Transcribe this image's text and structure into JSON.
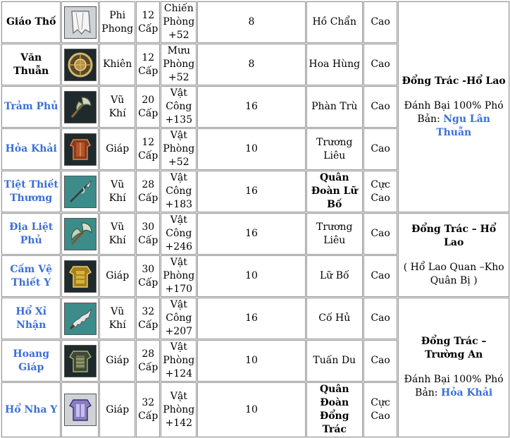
{
  "rows": [
    {
      "name": "Giáo Thố",
      "name_color": "black",
      "icon": "white-cloak-icon",
      "icon_bg": "ic-grey",
      "type": "Phi Phong",
      "level": "12 Cấp",
      "stat": "Chiến Phòng +52",
      "qty": "8",
      "source": "Hồ Chẩn",
      "source_bold": false,
      "grade": "Cao"
    },
    {
      "name": "Văn Thuẫn",
      "name_color": "black",
      "icon": "round-shield-icon",
      "icon_bg": "ic-dark",
      "type": "Khiên",
      "level": "12 Cấp",
      "stat": "Mưu Phòng +52",
      "qty": "8",
      "source": "Hoa Hùng",
      "source_bold": false,
      "grade": "Cao"
    },
    {
      "name": "Trảm Phủ",
      "name_color": "blue",
      "icon": "axe-icon",
      "icon_bg": "ic-dark",
      "type": "Vũ Khí",
      "level": "20 Cấp",
      "stat": "Vật Công +135",
      "qty": "16",
      "source": "Phàn Trù",
      "source_bold": false,
      "grade": "Cao"
    },
    {
      "name": "Hỏa Khải",
      "name_color": "blue",
      "icon": "red-armor-icon",
      "icon_bg": "ic-dark",
      "type": "Giáp",
      "level": "12 Cấp",
      "stat": "Vật Phòng +52",
      "qty": "10",
      "source": "Trương Liêu",
      "source_bold": false,
      "grade": "Cao"
    },
    {
      "name": "Tiệt Thiết Thương",
      "name_color": "blue",
      "icon": "spear-icon",
      "icon_bg": "ic-teal",
      "type": "Vũ Khí",
      "level": "28 Cấp",
      "stat": "Vật Công +183",
      "qty": "16",
      "source": "Quân Đoàn Lữ Bố",
      "source_bold": true,
      "grade": "Cực Cao"
    },
    {
      "name": "Địa Liệt Phủ",
      "name_color": "blue",
      "icon": "double-axe-icon",
      "icon_bg": "ic-teal",
      "type": "Vũ Khí",
      "level": "30 Cấp",
      "stat": "Vật Công +246",
      "qty": "16",
      "source": "Trương Liêu",
      "source_bold": false,
      "grade": "Cao"
    },
    {
      "name": "Cấm Vệ Thiết Y",
      "name_color": "blue",
      "icon": "gold-armor-icon",
      "icon_bg": "ic-dark",
      "type": "Giáp",
      "level": "30 Cấp",
      "stat": "Vật Phòng +170",
      "qty": "10",
      "source": "Lữ Bố",
      "source_bold": false,
      "grade": "Cao"
    },
    {
      "name": "Hổ Xỉ Nhận",
      "name_color": "blue",
      "icon": "serrated-blade-icon",
      "icon_bg": "ic-teal",
      "type": "Vũ Khí",
      "level": "32 Cấp",
      "stat": "Vật Công +207",
      "qty": "16",
      "source": "Cố Hủ",
      "source_bold": false,
      "grade": "Cao"
    },
    {
      "name": "Hoang Giáp",
      "name_color": "blue",
      "icon": "dark-armor-icon",
      "icon_bg": "ic-dark",
      "type": "Giáp",
      "level": "28 Cấp",
      "stat": "Vật Phòng +124",
      "qty": "10",
      "source": "Tuấn Du",
      "source_bold": false,
      "grade": "Cao"
    },
    {
      "name": "Hổ Nha Y",
      "name_color": "blue",
      "icon": "purple-armor-icon",
      "icon_bg": "ic-grey",
      "type": "Giáp",
      "level": "32 Cấp",
      "stat": "Vật Phòng +142",
      "qty": "10",
      "source": "Quân Đoàn Đổng Trác",
      "source_bold": true,
      "grade": "Cực Cao"
    }
  ],
  "locations": [
    {
      "title": "Đổng Trác -Hổ Lao",
      "note": "Đánh Bại 100% Phó Bản:",
      "link": "Ngu Lân Thuẫn"
    },
    {
      "title": "Đổng Trác – Hổ Lao",
      "note": "( Hổ Lao Quan –Kho Quân Bị )",
      "link": ""
    },
    {
      "title": "Đổng Trác – Trường An",
      "note": "Đánh Bại 100% Phó Bản:",
      "link": "Hỏa Khải"
    }
  ]
}
